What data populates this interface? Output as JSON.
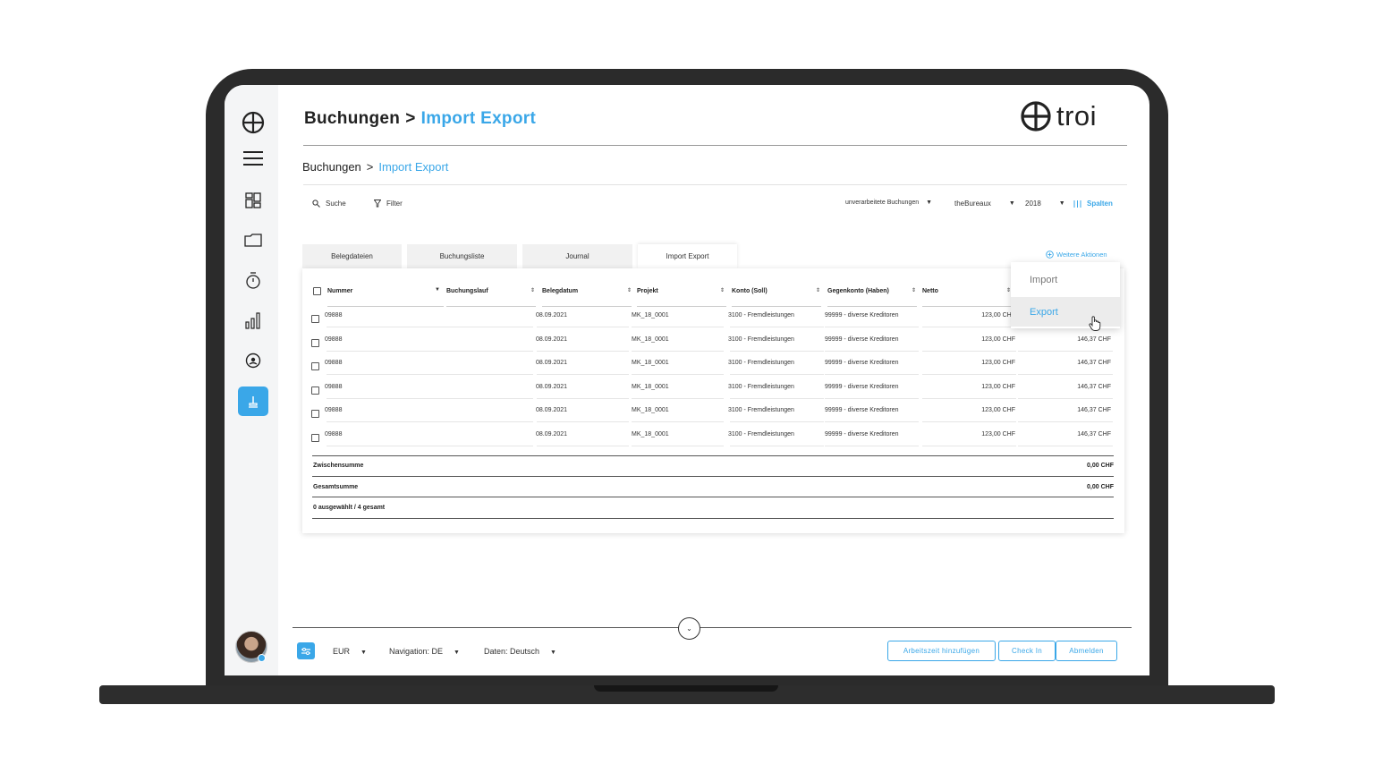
{
  "page": {
    "title_parent": "Buchungen",
    "title_separator": ">",
    "title_current": "Import Export",
    "logo_text": "troi"
  },
  "breadcrumb": {
    "parent": "Buchungen",
    "separator": ">",
    "current": "Import Export"
  },
  "toolbar": {
    "search_label": "Suche",
    "filter_label": "Filter",
    "status_select": "unverarbeitete Buchungen",
    "company_select": "theBureaux",
    "year_select": "2018",
    "columns_label": "Spalten"
  },
  "tabs": [
    {
      "label": "Belegdateien"
    },
    {
      "label": "Buchungsliste"
    },
    {
      "label": "Journal"
    },
    {
      "label": "Import Export"
    }
  ],
  "more_actions": "Weitere Aktionen",
  "dropdown": {
    "import": "Import",
    "export": "Export"
  },
  "table": {
    "headers": [
      "Nummer",
      "Buchungslauf",
      "Belegdatum",
      "Projekt",
      "Konto (Soll)",
      "Gegenkonto (Haben)",
      "Netto"
    ],
    "rows": [
      {
        "nummer": "09888",
        "lauf": "",
        "datum": "08.09.2021",
        "projekt": "MK_18_0001",
        "konto": "3100 - Fremdleistungen",
        "gegenkonto": "99999 - diverse Kreditoren",
        "netto": "123,00 CHF",
        "brutto": ""
      },
      {
        "nummer": "09888",
        "lauf": "",
        "datum": "08.09.2021",
        "projekt": "MK_18_0001",
        "konto": "3100 - Fremdleistungen",
        "gegenkonto": "99999 - diverse Kreditoren",
        "netto": "123,00 CHF",
        "brutto": "146,37 CHF"
      },
      {
        "nummer": "09888",
        "lauf": "",
        "datum": "08.09.2021",
        "projekt": "MK_18_0001",
        "konto": "3100 - Fremdleistungen",
        "gegenkonto": "99999 - diverse Kreditoren",
        "netto": "123,00 CHF",
        "brutto": "146,37 CHF"
      },
      {
        "nummer": "09888",
        "lauf": "",
        "datum": "08.09.2021",
        "projekt": "MK_18_0001",
        "konto": "3100 - Fremdleistungen",
        "gegenkonto": "99999 - diverse Kreditoren",
        "netto": "123,00 CHF",
        "brutto": "146,37 CHF"
      },
      {
        "nummer": "09888",
        "lauf": "",
        "datum": "08.09.2021",
        "projekt": "MK_18_0001",
        "konto": "3100 - Fremdleistungen",
        "gegenkonto": "99999 - diverse Kreditoren",
        "netto": "123,00 CHF",
        "brutto": "146,37 CHF"
      },
      {
        "nummer": "09888",
        "lauf": "",
        "datum": "08.09.2021",
        "projekt": "MK_18_0001",
        "konto": "3100 - Fremdleistungen",
        "gegenkonto": "99999 - diverse Kreditoren",
        "netto": "123,00 CHF",
        "brutto": "146,37 CHF"
      }
    ],
    "subtotal_label": "Zwischensumme",
    "subtotal_value": "0,00 CHF",
    "total_label": "Gesamtsumme",
    "total_value": "0,00 CHF",
    "selection_info": "0 ausgewählt / 4 gesamt"
  },
  "footer": {
    "currency": "EUR",
    "navigation": "Navigation: DE",
    "data_language": "Daten: Deutsch",
    "add_worktime": "Arbeitszeit hinzufügen",
    "check_in": "Check In",
    "logout": "Abmelden"
  },
  "colors": {
    "accent": "#3aa7e8",
    "bezel": "#2b2b2b"
  }
}
